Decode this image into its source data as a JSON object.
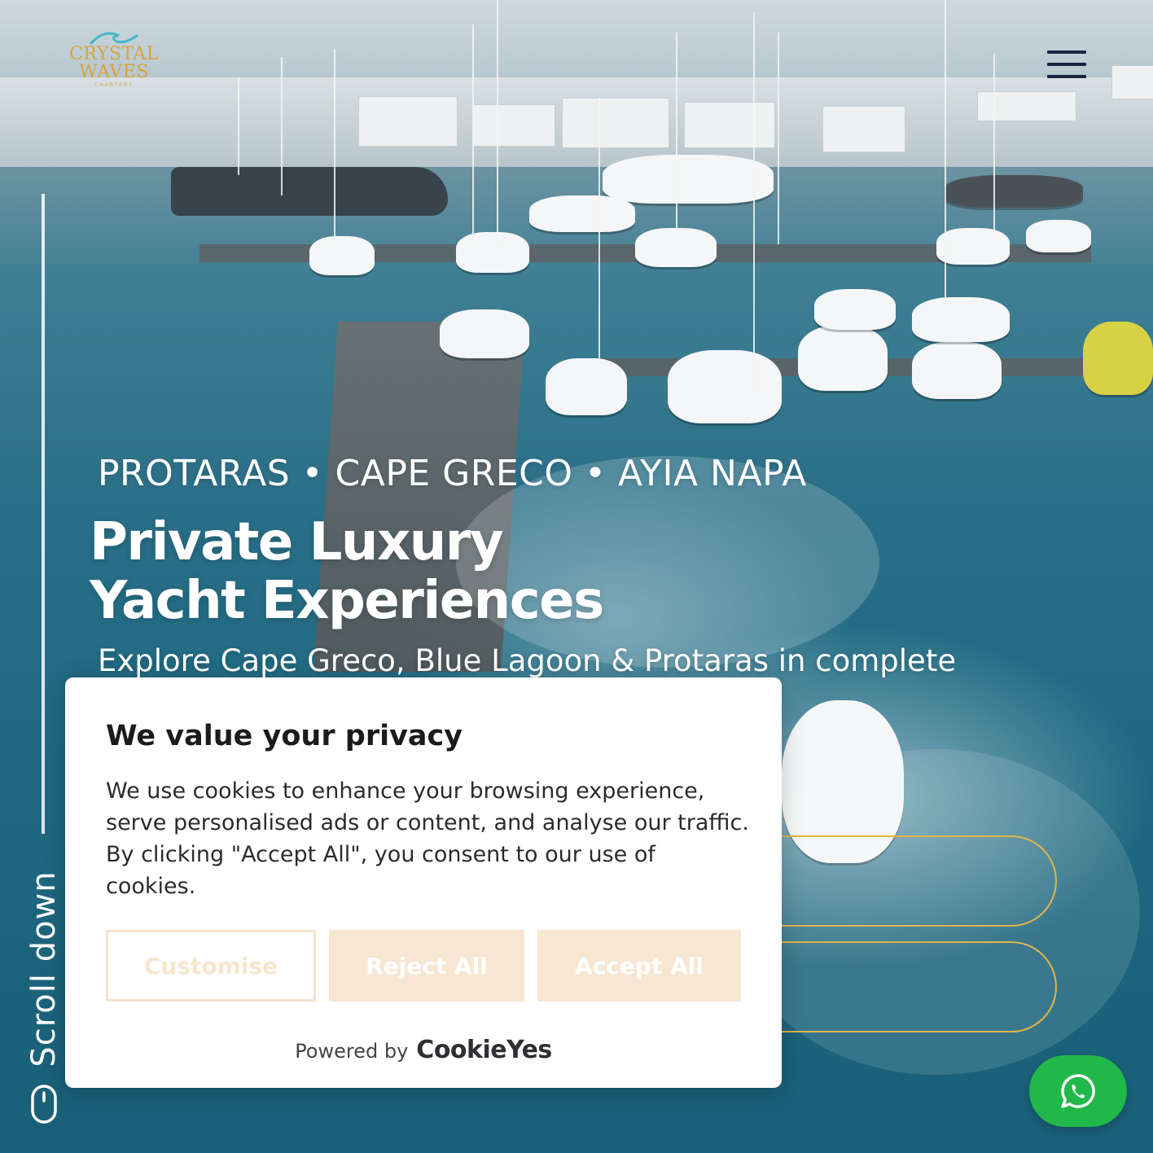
{
  "brand": {
    "logo_line1": "CRYSTAL",
    "logo_line2": "WAVES",
    "logo_line3": "CHARTERS",
    "accent_color": "#d7a33d"
  },
  "header": {
    "menu_icon": "hamburger-menu-icon"
  },
  "hero": {
    "locations": "PROTARAS • CAPE GRECO • AYIA NAPA",
    "title_line1": "Private Luxury",
    "title_line2": "Yacht Experiences",
    "subtitle": "Explore Cape Greco, Blue Lagoon & Protaras in complete"
  },
  "scroll": {
    "label": "Scroll down",
    "icon": "mouse-icon"
  },
  "cookie_banner": {
    "title": "We value your privacy",
    "body": "We use cookies to enhance your browsing experience, serve personalised ads or content, and analyse our traffic. By clicking \"Accept All\", you consent to our use of cookies.",
    "customise_label": "Customise",
    "reject_label": "Reject All",
    "accept_label": "Accept All",
    "powered_by": "Powered by",
    "powered_brand": "CookieYes"
  },
  "whatsapp": {
    "icon": "whatsapp-icon",
    "color": "#21b84a"
  }
}
